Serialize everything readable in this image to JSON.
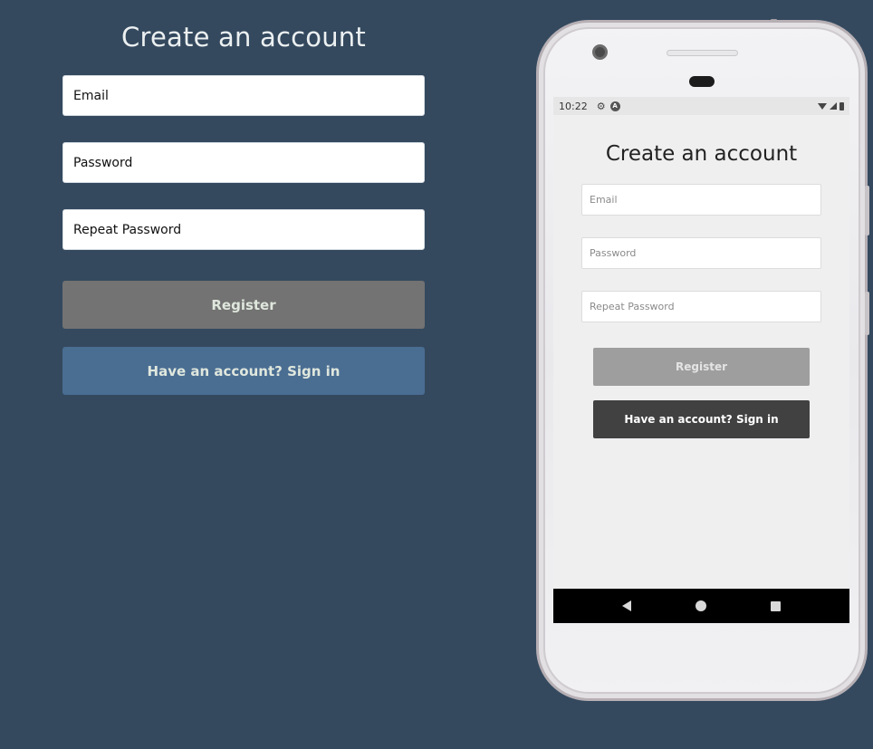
{
  "desktop": {
    "title": "Create an account",
    "email_placeholder": "Email",
    "password_placeholder": "Password",
    "repeat_password_placeholder": "Repeat Password",
    "register_label": "Register",
    "signin_label": "Have an account? Sign in"
  },
  "phone": {
    "status_bar": {
      "time": "10:22"
    },
    "title": "Create an account",
    "email_placeholder": "Email",
    "password_placeholder": "Password",
    "repeat_password_placeholder": "Repeat Password",
    "register_label": "Register",
    "signin_label": "Have an account? Sign in",
    "icons": {
      "settings": "gear-icon",
      "app": "a-badge-icon",
      "wifi": "wifi-icon",
      "signal": "signal-icon",
      "battery": "battery-icon",
      "back": "back-icon",
      "home": "home-icon",
      "recents": "recents-icon"
    }
  },
  "colors": {
    "background": "#34495e",
    "desktop_register_button": "#737373",
    "desktop_signin_button": "#4a6d92",
    "phone_register_button": "#9e9e9e",
    "phone_signin_button": "#414141"
  }
}
